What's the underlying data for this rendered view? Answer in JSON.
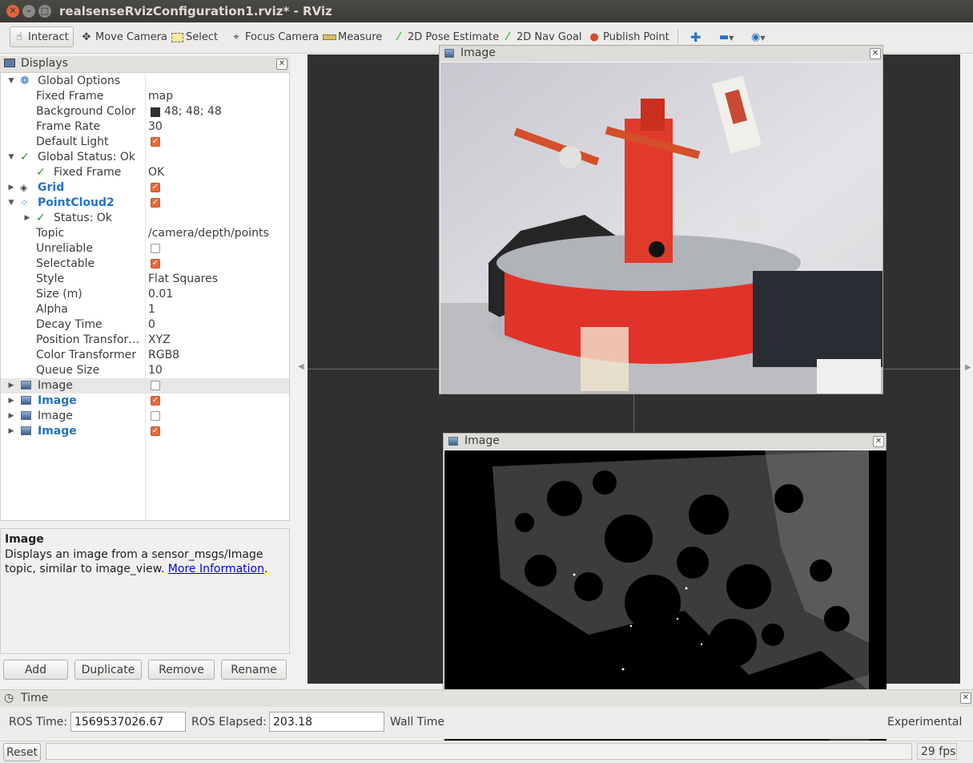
{
  "window": {
    "title": "realsenseRvizConfiguration1.rviz* - RViz"
  },
  "toolbar": {
    "interact": "Interact",
    "move_camera": "Move Camera",
    "select": "Select",
    "focus_camera": "Focus Camera",
    "measure": "Measure",
    "pose_estimate": "2D Pose Estimate",
    "nav_goal": "2D Nav Goal",
    "publish_point": "Publish Point"
  },
  "displays": {
    "title": "Displays",
    "global_options": "Global Options",
    "fixed_frame_label": "Fixed Frame",
    "fixed_frame_value": "map",
    "bg_color_label": "Background Color",
    "bg_color_value": "48; 48; 48",
    "frame_rate_label": "Frame Rate",
    "frame_rate_value": "30",
    "default_light_label": "Default Light",
    "global_status": "Global Status: Ok",
    "status_fixed_frame": "Fixed Frame",
    "status_fixed_frame_value": "OK",
    "grid": "Grid",
    "pointcloud": "PointCloud2",
    "pc_status": "Status: Ok",
    "topic_label": "Topic",
    "topic_value": "/camera/depth/points",
    "unreliable_label": "Unreliable",
    "selectable_label": "Selectable",
    "style_label": "Style",
    "style_value": "Flat Squares",
    "size_label": "Size (m)",
    "size_value": "0.01",
    "alpha_label": "Alpha",
    "alpha_value": "1",
    "decay_label": "Decay Time",
    "decay_value": "0",
    "position_label": "Position Transfor…",
    "position_value": "XYZ",
    "color_label": "Color Transformer",
    "color_value": "RGB8",
    "queue_label": "Queue Size",
    "queue_value": "10",
    "images": [
      "Image",
      "Image",
      "Image",
      "Image"
    ]
  },
  "description": {
    "heading": "Image",
    "text": "Displays an image from a sensor_msgs/Image topic, similar to image_view.",
    "link": "More Information",
    "end": "."
  },
  "buttons": {
    "add": "Add",
    "duplicate": "Duplicate",
    "remove": "Remove",
    "rename": "Rename"
  },
  "image_windows": {
    "top": "Image",
    "bottom": "Image"
  },
  "time": {
    "title": "Time",
    "ros_time_label": "ROS Time:",
    "ros_time_value": "1569537026.67",
    "ros_elapsed_label": "ROS Elapsed:",
    "ros_elapsed_value": "203.18",
    "wall_time_label": "Wall Time",
    "experimental": "Experimental",
    "reset": "Reset",
    "fps": "29 fps"
  },
  "colors": {
    "accent_blue": "#2672c4",
    "checkbox_on": "#e66a3c",
    "viewport_bg": "#303030"
  }
}
